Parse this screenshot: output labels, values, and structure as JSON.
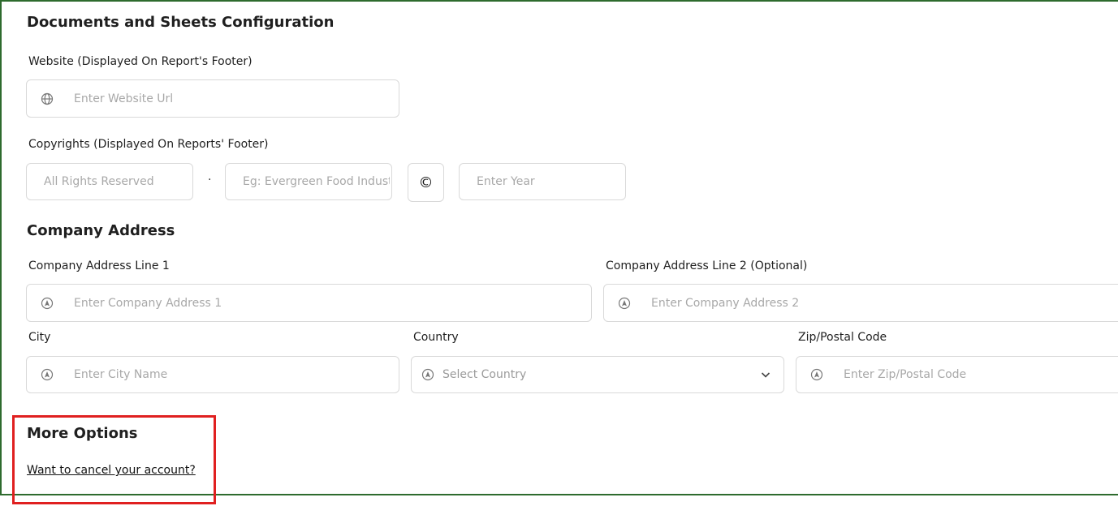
{
  "docs": {
    "title": "Documents and Sheets Configuration",
    "website_label": "Website (Displayed On Report's Footer)",
    "website_placeholder": "Enter Website Url",
    "copyrights_label": "Copyrights (Displayed On Reports' Footer)",
    "rights_placeholder": "All Rights Reserved",
    "separator": "·",
    "company_placeholder": "Eg: Evergreen Food Indust",
    "copyright_symbol": "©",
    "year_placeholder": "Enter Year"
  },
  "address": {
    "title": "Company Address",
    "line1_label": "Company Address Line 1",
    "line1_placeholder": "Enter Company Address 1",
    "line2_label": "Company Address Line 2 (Optional)",
    "line2_placeholder": "Enter Company Address 2",
    "city_label": "City",
    "city_placeholder": "Enter City Name",
    "country_label": "Country",
    "country_placeholder": "Select Country",
    "zip_label": "Zip/Postal Code",
    "zip_placeholder": "Enter Zip/Postal Code"
  },
  "more": {
    "title": "More Options",
    "cancel_link": "Want to cancel your account?"
  },
  "colors": {
    "frame_border": "#2e6b2e",
    "highlight_border": "#e02020",
    "input_border": "#d9d9d9",
    "placeholder": "#a8a8a8"
  },
  "icons": {
    "website": "globe-icon",
    "address": "navigation-icon",
    "dropdown": "chevron-down-icon"
  }
}
